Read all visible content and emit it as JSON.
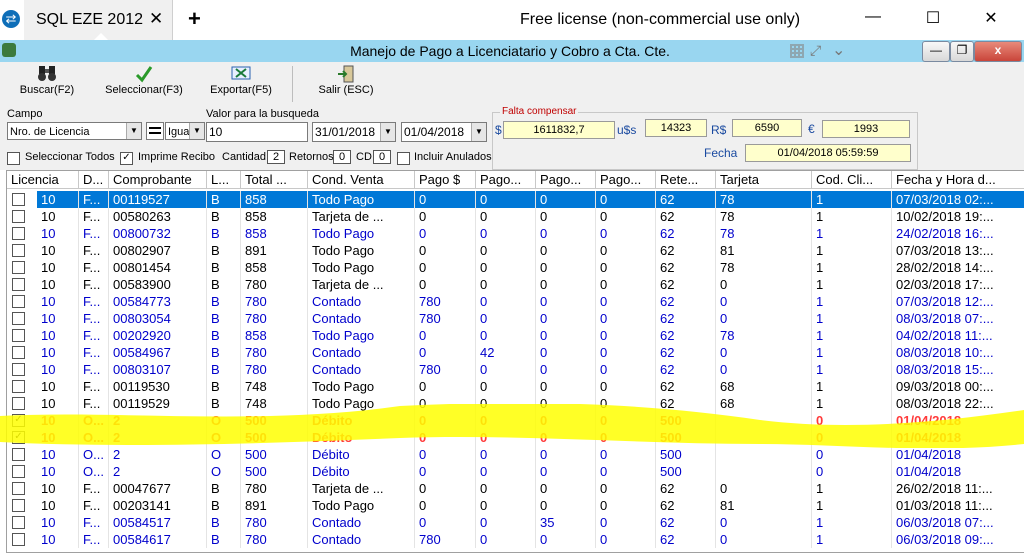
{
  "teamviewer": {
    "tab_title": "SQL EZE 2012",
    "tab_close": "✕",
    "new_tab": "+",
    "license_text": "Free license (non-commercial use only)",
    "minimize": "—",
    "maximize": "☐",
    "close": "✕"
  },
  "app": {
    "title": "Manejo de Pago a Licenciatario y Cobro a Cta. Cte.",
    "win_min": "—",
    "win_restore": "❐",
    "win_close": "x"
  },
  "toolbar": {
    "buscar": "Buscar(F2)",
    "seleccionar": "Seleccionar(F3)",
    "exportar": "Exportar(F5)",
    "salir": "Salir (ESC)"
  },
  "filters": {
    "campo_label": "Campo",
    "campo_value": "Nro. de Licencia",
    "operator_value": "Igua",
    "valor_label": "Valor para la busqueda",
    "valor_value": "10",
    "date_from": "31/01/2018",
    "date_to": "01/04/2018",
    "seleccionar_todos": "Seleccionar Todos",
    "imprime_recibo": "Imprime Recibo",
    "imprime_recibo_checked": true,
    "cantidad_label": "Cantidad",
    "cantidad_value": "2",
    "retornos_label": "Retornos",
    "retornos_value": "0",
    "cd_label": "CD",
    "cd_value": "0",
    "incluir_anulados": "Incluir Anulados"
  },
  "balance": {
    "legend": "Falta compensar",
    "ars_symbol": "$",
    "ars_value": "1611832,7",
    "usd_symbol": "u$s",
    "usd_value": "14323",
    "brl_symbol": "R$",
    "brl_value": "6590",
    "eur_symbol": "€",
    "eur_value": "1993",
    "fecha_label": "Fecha",
    "fecha_value": "01/04/2018 05:59:59"
  },
  "grid": {
    "columns": [
      "Licencia",
      "D...",
      "Comprobante",
      "L...",
      "Total ...",
      "Cond. Venta",
      "Pago $",
      "Pago...",
      "Pago...",
      "Pago...",
      "Rete...",
      "Tarjeta",
      "Cod. Cli...",
      "Fecha y Hora d..."
    ],
    "rows": [
      {
        "checked": false,
        "style": "selected",
        "cells": [
          "10",
          "F...",
          "00119527",
          "B",
          "858",
          "Todo Pago",
          "0",
          "0",
          "0",
          "0",
          "62",
          "78",
          "1",
          "07/03/2018 02:..."
        ]
      },
      {
        "checked": false,
        "style": "black",
        "cells": [
          "10",
          "F...",
          "00580263",
          "B",
          "858",
          "Tarjeta de ...",
          "0",
          "0",
          "0",
          "0",
          "62",
          "78",
          "1",
          "10/02/2018 19:..."
        ]
      },
      {
        "checked": false,
        "style": "blue",
        "cells": [
          "10",
          "F...",
          "00800732",
          "B",
          "858",
          "Todo Pago",
          "0",
          "0",
          "0",
          "0",
          "62",
          "78",
          "1",
          "24/02/2018 16:..."
        ]
      },
      {
        "checked": false,
        "style": "black",
        "cells": [
          "10",
          "F...",
          "00802907",
          "B",
          "891",
          "Todo Pago",
          "0",
          "0",
          "0",
          "0",
          "62",
          "81",
          "1",
          "07/03/2018 13:..."
        ]
      },
      {
        "checked": false,
        "style": "black",
        "cells": [
          "10",
          "F...",
          "00801454",
          "B",
          "858",
          "Todo Pago",
          "0",
          "0",
          "0",
          "0",
          "62",
          "78",
          "1",
          "28/02/2018 14:..."
        ]
      },
      {
        "checked": false,
        "style": "black",
        "cells": [
          "10",
          "F...",
          "00583900",
          "B",
          "780",
          "Tarjeta de ...",
          "0",
          "0",
          "0",
          "0",
          "62",
          "0",
          "1",
          "02/03/2018 17:..."
        ]
      },
      {
        "checked": false,
        "style": "blue",
        "cells": [
          "10",
          "F...",
          "00584773",
          "B",
          "780",
          "Contado",
          "780",
          "0",
          "0",
          "0",
          "62",
          "0",
          "1",
          "07/03/2018 12:..."
        ]
      },
      {
        "checked": false,
        "style": "blue",
        "cells": [
          "10",
          "F...",
          "00803054",
          "B",
          "780",
          "Contado",
          "780",
          "0",
          "0",
          "0",
          "62",
          "0",
          "1",
          "08/03/2018 07:..."
        ]
      },
      {
        "checked": false,
        "style": "blue",
        "cells": [
          "10",
          "F...",
          "00202920",
          "B",
          "858",
          "Todo Pago",
          "0",
          "0",
          "0",
          "0",
          "62",
          "78",
          "1",
          "04/02/2018 11:..."
        ]
      },
      {
        "checked": false,
        "style": "blue",
        "cells": [
          "10",
          "F...",
          "00584967",
          "B",
          "780",
          "Contado",
          "0",
          "42",
          "0",
          "0",
          "62",
          "0",
          "1",
          "08/03/2018 10:..."
        ]
      },
      {
        "checked": false,
        "style": "blue",
        "cells": [
          "10",
          "F...",
          "00803107",
          "B",
          "780",
          "Contado",
          "780",
          "0",
          "0",
          "0",
          "62",
          "0",
          "1",
          "08/03/2018 15:..."
        ]
      },
      {
        "checked": false,
        "style": "black",
        "cells": [
          "10",
          "F...",
          "00119530",
          "B",
          "748",
          "Todo Pago",
          "0",
          "0",
          "0",
          "0",
          "62",
          "68",
          "1",
          "09/03/2018 00:..."
        ]
      },
      {
        "checked": false,
        "style": "black",
        "cells": [
          "10",
          "F...",
          "00119529",
          "B",
          "748",
          "Todo Pago",
          "0",
          "0",
          "0",
          "0",
          "62",
          "68",
          "1",
          "08/03/2018 22:..."
        ]
      },
      {
        "checked": true,
        "style": "red",
        "cells": [
          "10",
          "O...",
          "2",
          "O",
          "500",
          "Débito",
          "0",
          "0",
          "0",
          "0",
          "500",
          "",
          "0",
          "01/04/2018"
        ]
      },
      {
        "checked": true,
        "style": "red",
        "cells": [
          "10",
          "O...",
          "2",
          "O",
          "500",
          "Débito",
          "0",
          "0",
          "0",
          "0",
          "500",
          "",
          "0",
          "01/04/2018"
        ]
      },
      {
        "checked": false,
        "style": "blue",
        "cells": [
          "10",
          "O...",
          "2",
          "O",
          "500",
          "Débito",
          "0",
          "0",
          "0",
          "0",
          "500",
          "",
          "0",
          "01/04/2018"
        ]
      },
      {
        "checked": false,
        "style": "blue",
        "cells": [
          "10",
          "O...",
          "2",
          "O",
          "500",
          "Débito",
          "0",
          "0",
          "0",
          "0",
          "500",
          "",
          "0",
          "01/04/2018"
        ]
      },
      {
        "checked": false,
        "style": "black",
        "cells": [
          "10",
          "F...",
          "00047677",
          "B",
          "780",
          "Tarjeta de ...",
          "0",
          "0",
          "0",
          "0",
          "62",
          "0",
          "1",
          "26/02/2018 11:..."
        ]
      },
      {
        "checked": false,
        "style": "black",
        "cells": [
          "10",
          "F...",
          "00203141",
          "B",
          "891",
          "Todo Pago",
          "0",
          "0",
          "0",
          "0",
          "62",
          "81",
          "1",
          "01/03/2018 11:..."
        ]
      },
      {
        "checked": false,
        "style": "blue",
        "cells": [
          "10",
          "F...",
          "00584517",
          "B",
          "780",
          "Contado",
          "0",
          "0",
          "35",
          "0",
          "62",
          "0",
          "1",
          "06/03/2018 07:..."
        ]
      },
      {
        "checked": false,
        "style": "blue",
        "cells": [
          "10",
          "F...",
          "00584617",
          "B",
          "780",
          "Contado",
          "780",
          "0",
          "0",
          "0",
          "62",
          "0",
          "1",
          "06/03/2018 09:..."
        ]
      }
    ]
  },
  "colors": {
    "titlebar": "#99d6f0",
    "selected_row": "#0078d7",
    "blue_text": "#0000cc",
    "red_text": "#ff3b3b",
    "highlight": "#ffff00"
  }
}
